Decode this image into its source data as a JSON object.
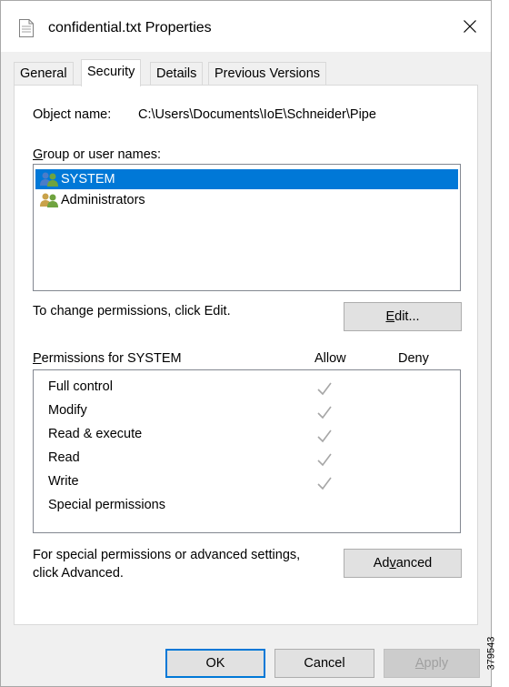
{
  "window": {
    "title": "confidential.txt Properties",
    "icons": {
      "file": "text-file-icon",
      "close": "close-icon"
    }
  },
  "tabs": [
    {
      "label": "General",
      "active": false
    },
    {
      "label": "Security",
      "active": true
    },
    {
      "label": "Details",
      "active": false
    },
    {
      "label": "Previous Versions",
      "active": false
    }
  ],
  "security": {
    "object_name_label": "Object name:",
    "object_name_value": "C:\\Users\\Documents\\IoE\\Schneider\\Pipe",
    "group_label_mnemonic": "G",
    "group_label_rest": "roup or user names:",
    "users": [
      {
        "name": "SYSTEM",
        "selected": true,
        "icon": "user-group-icon"
      },
      {
        "name": "Administrators",
        "selected": false,
        "icon": "user-group-icon"
      }
    ],
    "change_text": "To change permissions, click Edit.",
    "edit_button_mnemonic": "E",
    "edit_button_rest": "dit...",
    "permissions_label_mnemonic": "P",
    "permissions_label_rest": "ermissions for SYSTEM",
    "allow_header": "Allow",
    "deny_header": "Deny",
    "permissions": [
      {
        "name": "Full control",
        "allow": true,
        "deny": false
      },
      {
        "name": "Modify",
        "allow": true,
        "deny": false
      },
      {
        "name": "Read & execute",
        "allow": true,
        "deny": false
      },
      {
        "name": "Read",
        "allow": true,
        "deny": false
      },
      {
        "name": "Write",
        "allow": true,
        "deny": false
      },
      {
        "name": "Special permissions",
        "allow": false,
        "deny": false
      }
    ],
    "advanced_text_line1": "For special permissions or advanced settings,",
    "advanced_text_line2": "click Advanced.",
    "advanced_button_pre": "Ad",
    "advanced_button_mnemonic": "v",
    "advanced_button_post": "anced"
  },
  "footer": {
    "ok_label": "OK",
    "cancel_label": "Cancel",
    "apply_mnemonic": "A",
    "apply_rest": "pply",
    "apply_disabled": true
  },
  "watermark": "379543",
  "colors": {
    "selection": "#0078d7",
    "window_bg": "#f0f0f0",
    "check_gray": "#a6a6a6"
  }
}
